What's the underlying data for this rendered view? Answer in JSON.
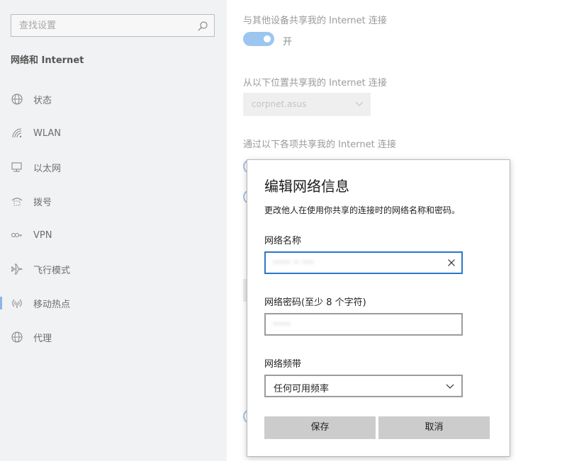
{
  "sidebar": {
    "search_placeholder": "查找设置",
    "section_title": "网络和 Internet",
    "items": [
      {
        "label": "状态",
        "icon": "globe-status-icon"
      },
      {
        "label": "WLAN",
        "icon": "wifi-icon"
      },
      {
        "label": "以太网",
        "icon": "ethernet-icon"
      },
      {
        "label": "拨号",
        "icon": "dialup-icon"
      },
      {
        "label": "VPN",
        "icon": "vpn-icon"
      },
      {
        "label": "飞行模式",
        "icon": "airplane-icon"
      },
      {
        "label": "移动热点",
        "icon": "hotspot-icon"
      },
      {
        "label": "代理",
        "icon": "globe-proxy-icon"
      }
    ],
    "active_item": "移动热点"
  },
  "main": {
    "share_label": "与其他设备共享我的 Internet 连接",
    "toggle_state": "开",
    "share_from_label": "从以下位置共享我的 Internet 连接",
    "share_from_value": "corpnet.asus",
    "share_over_label": "通过以下各项共享我的 Internet 连接"
  },
  "dialog": {
    "title": "编辑网络信息",
    "description": "更改他人在使用你共享的连接时的网络名称和密码。",
    "network_name_label": "网络名称",
    "network_name_value": "······ ·· ····",
    "network_password_label": "网络密码(至少 8 个字符)",
    "network_password_value": "······",
    "band_label": "网络频带",
    "band_value": "任何可用频率",
    "save_label": "保存",
    "cancel_label": "取消"
  },
  "colors": {
    "accent": "#2a78c8",
    "toggle_on": "#9cc6f0",
    "sidebar_bg": "#f1f2f3",
    "button_bg": "#cccccc"
  }
}
